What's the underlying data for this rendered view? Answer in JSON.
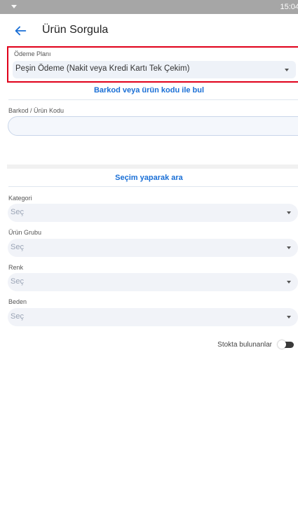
{
  "status_bar": {
    "time": "15:04",
    "left_icon": "wifi-icon"
  },
  "app_bar": {
    "title": "Ürün Sorgula",
    "back_icon": "arrow-left-icon"
  },
  "payment_plan": {
    "label": "Ödeme Planı",
    "selected": "Peşin Ödeme (Nakit veya Kredi Kartı Tek Çekim)"
  },
  "barcode_section": {
    "title": "Barkod veya ürün kodu ile bul",
    "field_label": "Barkod / Ürün Kodu",
    "value": ""
  },
  "filter_section": {
    "title": "Seçim yaparak ara",
    "filters": [
      {
        "label": "Kategori",
        "placeholder": "Seç"
      },
      {
        "label": "Ürün Grubu",
        "placeholder": "Seç"
      },
      {
        "label": "Renk",
        "placeholder": "Seç"
      },
      {
        "label": "Beden",
        "placeholder": "Seç"
      }
    ]
  },
  "stock_toggle": {
    "label": "Stokta bulunanlar",
    "on": false
  },
  "colors": {
    "accent": "#1a6fd6",
    "highlight_border": "#e0001a",
    "status_bar": "#a6a6a6"
  }
}
